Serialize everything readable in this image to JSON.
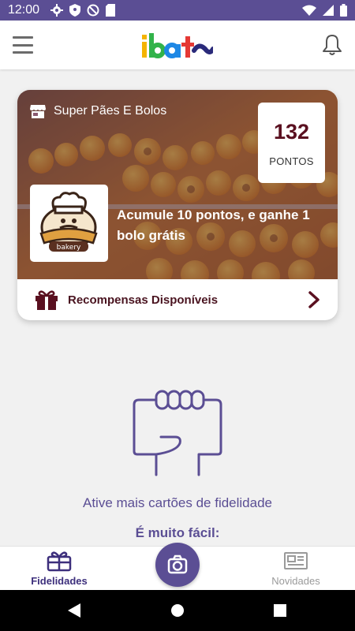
{
  "status_bar": {
    "time": "12:00",
    "left_icons": [
      "settings-icon",
      "shield-icon",
      "at-sign-icon",
      "sd-card-icon"
    ],
    "right_icons": [
      "wifi-icon",
      "signal-icon",
      "battery-icon"
    ],
    "color": "#5b4e94"
  },
  "header": {
    "logo_text": "ibato",
    "logo_colors": [
      "#f5b400",
      "#32b34a",
      "#1e88e5",
      "#e53935",
      "#2a2a7a"
    ]
  },
  "card": {
    "store_name": "Super Pães E Bolos",
    "points_value": "132",
    "points_label": "PONTOS",
    "logo_text": "bakery",
    "promo": "Acumule 10 pontos, e ganhe 1 bolo grátis",
    "rewards_label": "Recompensas Disponíveis",
    "accent_color": "#5a1020"
  },
  "empty_state": {
    "message": "Ative mais cartões de fidelidade",
    "subtitle": "É muito fácil:"
  },
  "bottom_nav": {
    "items": [
      {
        "label": "Fidelidades",
        "icon": "gift-card-icon",
        "active": true
      },
      {
        "label": "",
        "icon": "camera-icon",
        "active": false
      },
      {
        "label": "Novidades",
        "icon": "newspaper-icon",
        "active": false
      }
    ],
    "active_color": "#3d2f7c",
    "inactive_color": "#9a9a9a"
  },
  "system_nav": {
    "icons": [
      "back-icon",
      "home-icon",
      "recents-icon"
    ]
  }
}
